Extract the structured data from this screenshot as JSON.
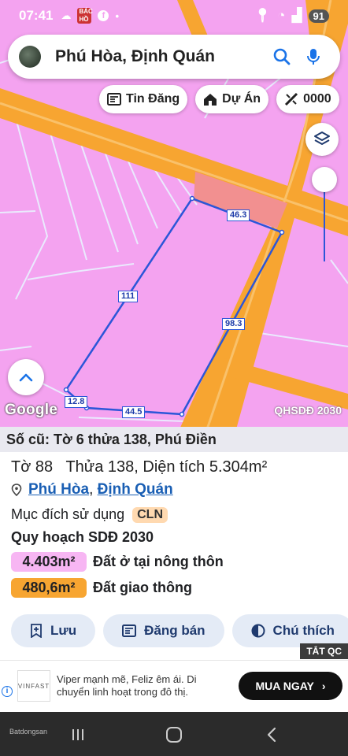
{
  "status_bar": {
    "time": "07:41",
    "notification_badge": "BÁC HỒ",
    "battery": "91"
  },
  "search": {
    "query": "Phú Hòa, Định Quán"
  },
  "chips": [
    {
      "label": "Tin Đăng",
      "icon": "news-icon"
    },
    {
      "label": "Dự Án",
      "icon": "building-icon"
    },
    {
      "label": "0000",
      "icon": "ruler-icon"
    }
  ],
  "map": {
    "google": "Google",
    "overlay_label": "QHSDĐ 2030",
    "dimensions": [
      "46.3",
      "111",
      "98.3",
      "12.8",
      "44.5"
    ]
  },
  "panel": {
    "old_info": "Số cũ: Tờ 6 thửa 138, Phú Điền",
    "sheet": "Tờ 88",
    "parcel": "Thửa 138",
    "area_label": "Diện tích",
    "area_value": "5.304m²",
    "ward": "Phú Hòa",
    "district": "Định Quán",
    "purpose_label": "Mục đích sử dụng",
    "purpose_code": "CLN",
    "plan_title": "Quy hoạch SDĐ 2030",
    "land_uses": [
      {
        "area": "4.403m²",
        "label": "Đất ở tại nông thôn",
        "color": "#f7b6f3"
      },
      {
        "area": "480,6m²",
        "label": "Đất giao thông",
        "color": "#f7a531"
      }
    ],
    "actions": [
      {
        "label": "Lưu",
        "icon": "bookmark-plus-icon"
      },
      {
        "label": "Đăng bán",
        "icon": "post-icon"
      },
      {
        "label": "Chú thích",
        "icon": "contrast-icon"
      }
    ]
  },
  "ad": {
    "close_label": "TẮT QC",
    "brand": "VINFAST",
    "text": "Viper mạnh mẽ, Feliz êm ái. Di chuyển linh hoạt trong đô thị.",
    "cta": "MUA NGAY"
  },
  "nav": {
    "brand": "Batdongsan"
  },
  "colors": {
    "map_pink": "#f4a3f0",
    "road_orange": "#f7a531",
    "plot_line": "#2b56d8"
  }
}
